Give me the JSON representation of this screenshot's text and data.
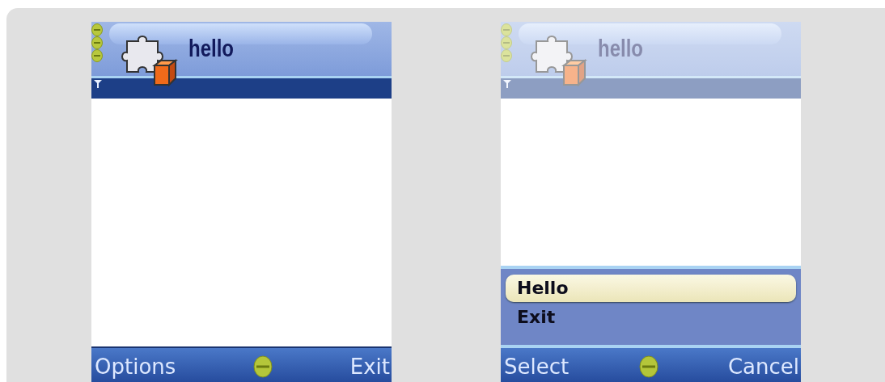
{
  "screens": [
    {
      "title": "hello",
      "dimmed": false,
      "softkeys": {
        "left": "Options",
        "right": "Exit"
      }
    },
    {
      "title": "hello",
      "dimmed": true,
      "softkeys": {
        "left": "Select",
        "right": "Cancel"
      },
      "menu": [
        {
          "label": "Hello",
          "selected": true
        },
        {
          "label": "Exit",
          "selected": false
        }
      ]
    }
  ]
}
